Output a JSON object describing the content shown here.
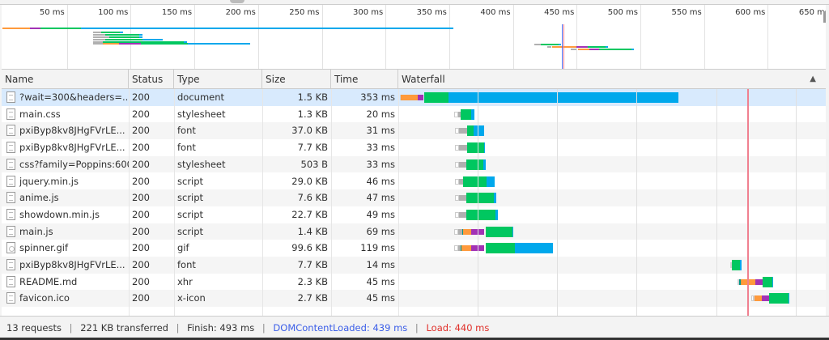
{
  "overview": {
    "ticks": [
      "50 ms",
      "100 ms",
      "150 ms",
      "200 ms",
      "250 ms",
      "300 ms",
      "350 ms",
      "400 ms",
      "450 ms",
      "500 ms",
      "550 ms",
      "600 ms",
      "650 ms"
    ]
  },
  "columns": {
    "name": "Name",
    "status": "Status",
    "type": "Type",
    "size": "Size",
    "time": "Time",
    "waterfall": "Waterfall",
    "sort_icon": "▲"
  },
  "requests": [
    {
      "name": "?wait=300&headers=...",
      "status": "200",
      "type": "document",
      "size": "1.5 KB",
      "time": "353 ms",
      "icon": "document-icon"
    },
    {
      "name": "main.css",
      "status": "200",
      "type": "stylesheet",
      "size": "1.3 KB",
      "time": "20 ms",
      "icon": "document-icon"
    },
    {
      "name": "pxiByp8kv8JHgFVrLE...",
      "status": "200",
      "type": "font",
      "size": "37.0 KB",
      "time": "31 ms",
      "icon": "document-icon"
    },
    {
      "name": "pxiByp8kv8JHgFVrLE...",
      "status": "200",
      "type": "font",
      "size": "7.7 KB",
      "time": "33 ms",
      "icon": "document-icon"
    },
    {
      "name": "css?family=Poppins:600",
      "status": "200",
      "type": "stylesheet",
      "size": "503 B",
      "time": "33 ms",
      "icon": "document-icon"
    },
    {
      "name": "jquery.min.js",
      "status": "200",
      "type": "script",
      "size": "29.0 KB",
      "time": "46 ms",
      "icon": "document-icon"
    },
    {
      "name": "anime.js",
      "status": "200",
      "type": "script",
      "size": "7.6 KB",
      "time": "47 ms",
      "icon": "document-icon"
    },
    {
      "name": "showdown.min.js",
      "status": "200",
      "type": "script",
      "size": "22.7 KB",
      "time": "49 ms",
      "icon": "document-icon"
    },
    {
      "name": "main.js",
      "status": "200",
      "type": "script",
      "size": "1.4 KB",
      "time": "69 ms",
      "icon": "document-icon"
    },
    {
      "name": "spinner.gif",
      "status": "200",
      "type": "gif",
      "size": "99.6 KB",
      "time": "119 ms",
      "icon": "image-icon"
    },
    {
      "name": "pxiByp8kv8JHgFVrLE...",
      "status": "200",
      "type": "font",
      "size": "7.7 KB",
      "time": "14 ms",
      "icon": "document-icon"
    },
    {
      "name": "README.md",
      "status": "200",
      "type": "xhr",
      "size": "2.3 KB",
      "time": "45 ms",
      "icon": "document-icon"
    },
    {
      "name": "favicon.ico",
      "status": "200",
      "type": "x-icon",
      "size": "2.7 KB",
      "time": "45 ms",
      "icon": "document-icon"
    }
  ],
  "footer": {
    "requests": "13 requests",
    "transferred": "221 KB transferred",
    "finish": "Finish: 493 ms",
    "dcl": "DOMContentLoaded: 439 ms",
    "load": "Load: 440 ms",
    "separator": "|"
  },
  "colors": {
    "queue": "#b0b0b0",
    "stalled": "#d0d0d0",
    "dns": "#009688",
    "connect": "#ff9a3c",
    "ssl": "#a232b5",
    "waiting": "#00c760",
    "download": "#00a8ec",
    "dcl_line": "#4c6cf0",
    "load_line": "#f08090"
  }
}
